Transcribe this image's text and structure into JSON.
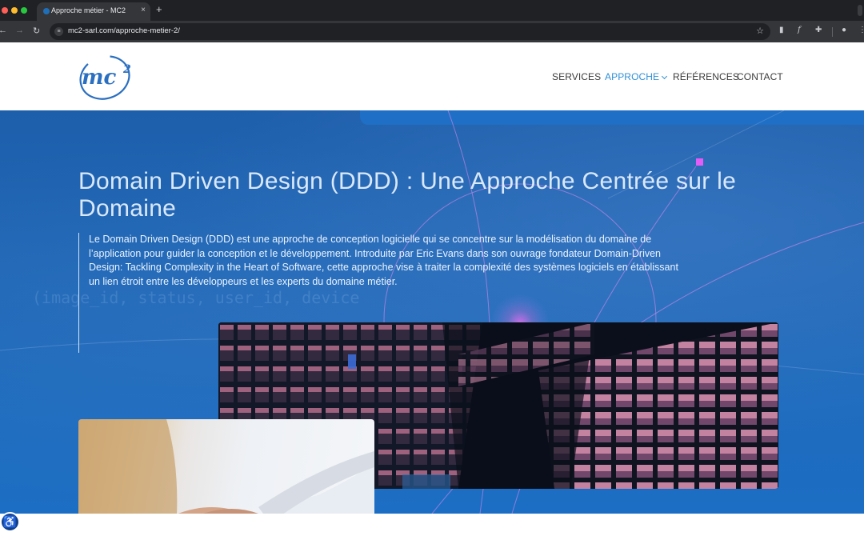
{
  "browser": {
    "tab_title": "Approche métier - MC2",
    "tab_close": "×",
    "new_tab": "+",
    "url": "mc2-sarl.com/approche-metier-2/",
    "nav_back": "←",
    "nav_forward": "→",
    "nav_reload": "↻",
    "bookmark_icon": "☆"
  },
  "site": {
    "logo_text": "mc",
    "logo_superscript": "2",
    "nav": {
      "services": "SERVICES",
      "approche": "APPROCHE",
      "references": "RÉFÉRENCES",
      "contact": "CONTACT"
    }
  },
  "hero": {
    "title": "Domain Driven Design (DDD) : Une Approche Centrée sur le Domaine",
    "paragraph": "Le Domain Driven Design (DDD) est une approche de conception logicielle qui se concentre sur la modélisation du domaine de l’application pour guider la conception et le développement. Introduite par Eric Evans dans son ouvrage fondateur Domain-Driven Design: Tackling Complexity in the Heart of Software, cette approche vise à traiter la complexité des systèmes logiciels en établissant un lien étroit entre les développeurs et les experts du domaine métier.",
    "code_background": [
      "(image_id, status, user_id, device",
      "image_id,",
      "status, user_id"
    ]
  },
  "colors": {
    "accent": "#2f8fd6",
    "hero_blue": "#1f67b6",
    "pink_marker": "#e25cf5"
  },
  "accessibility": {
    "icon": "♿"
  }
}
